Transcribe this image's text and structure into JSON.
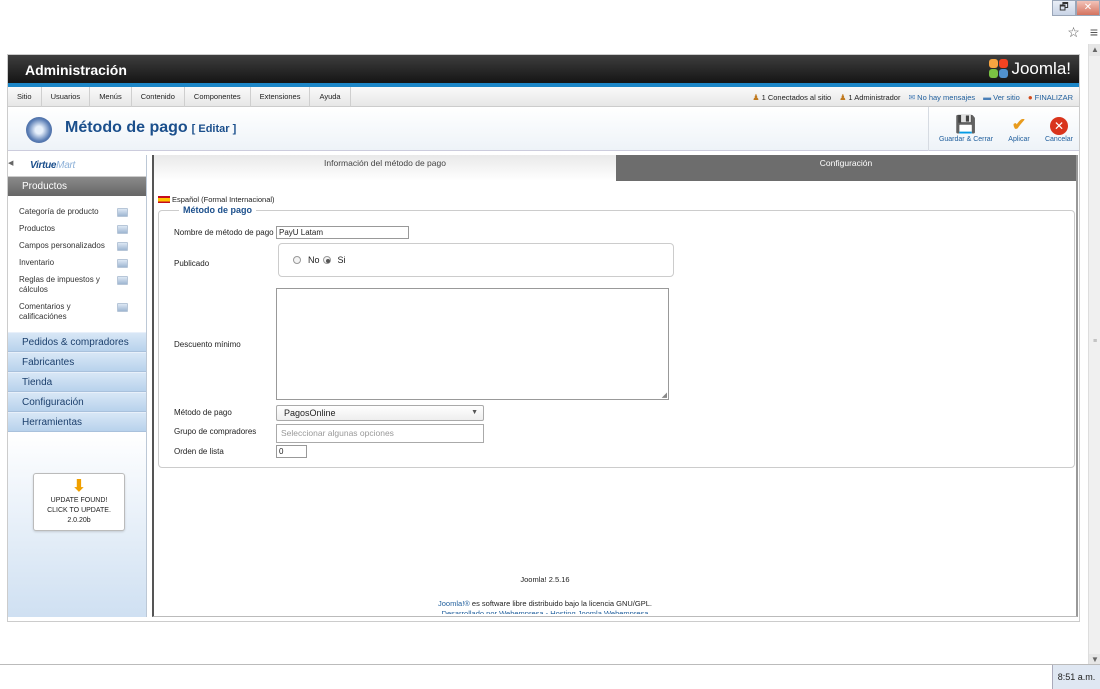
{
  "browser": {
    "window_buttons": [
      "🗗",
      "✕"
    ],
    "star_icon": "☆",
    "menu_icon": "≡",
    "clock": "8:51 a.m."
  },
  "header": {
    "title": "Administración",
    "logo_text": "Joomla!"
  },
  "menu": {
    "items": [
      "Sitio",
      "Usuarios",
      "Menús",
      "Contenido",
      "Componentes",
      "Extensiones",
      "Ayuda"
    ],
    "status": {
      "connected_site": "1 Conectados al sitio",
      "admin": "1 Administrador",
      "messages": "No hay mensajes",
      "view_site": "Ver sitio",
      "logout": "FINALIZAR"
    }
  },
  "toolbar": {
    "title": "Método de pago",
    "edit_tag": "[ Editar ]",
    "buttons": {
      "save_close": "Guardar & Cerrar",
      "apply": "Aplicar",
      "cancel": "Cancelar"
    }
  },
  "sidebar": {
    "brand_main": "Virtue",
    "brand_sub": "Mart",
    "section": "Productos",
    "links": [
      "Categoría de producto",
      "Productos",
      "Campos personalizados",
      "Inventario",
      "Reglas de impuestos y cálculos",
      "Comentarios y calificaciónes"
    ],
    "categories": [
      "Pedidos & compradores",
      "Fabricantes",
      "Tienda",
      "Configuración",
      "Herramientas"
    ],
    "update_box": {
      "line1": "UPDATE FOUND!",
      "line2": "CLICK TO UPDATE.",
      "line3": "2.0.20b"
    }
  },
  "main": {
    "tabs": [
      "Información del método de pago",
      "Configuración"
    ],
    "language": "Español (Formal Internacional)",
    "legend": "Método de pago",
    "fields": {
      "name_label": "Nombre de método de pago",
      "name_value": "PayU Latam",
      "published_label": "Publicado",
      "published_no": "No",
      "published_yes": "Si",
      "discount_label": "Descuento mínimo",
      "method_label": "Método de pago",
      "method_value": "PagosOnline",
      "group_label": "Grupo de compradores",
      "group_placeholder": "Seleccionar algunas opciones",
      "order_label": "Orden de lista",
      "order_value": "0"
    }
  },
  "footer": {
    "version": "Joomla! 2.5.16",
    "license_link": "Joomla!®",
    "license_text": " es software libre distribuido bajo la licencia GNU/GPL.",
    "powered": "Desarrollado por Webempresa - Hosting Joomla Webempresa"
  }
}
